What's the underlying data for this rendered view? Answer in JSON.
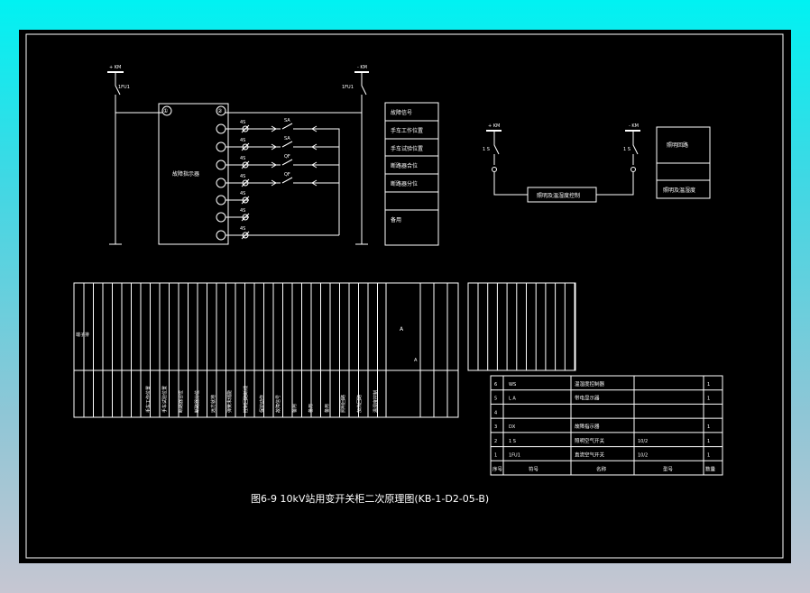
{
  "drawing": {
    "title": "图6-9 10kV站用变开关柜二次原理图(KB-1-D2-05-B)"
  },
  "left_circuit": {
    "device_label": "故障指示器",
    "bus_top_left": "+ KM",
    "bus_top_right": "- KM",
    "fuse_left": "1FU1",
    "fuse_right": "1FU1",
    "port_top": "①",
    "port_top_right": "②",
    "terminal_labels": [
      "4S",
      "4S",
      "4S",
      "4S",
      "4S",
      "4S",
      "4S"
    ],
    "contact_labels": [
      "SA",
      "SA",
      "QF",
      "QF"
    ],
    "signal_box": [
      "故障信号",
      "手车工作位置",
      "手车试验位置",
      "断路器合位",
      "断路器分位",
      "",
      "备用"
    ]
  },
  "right_circuit": {
    "device_label": "照明及温湿度控制",
    "bus_left": "+ KM",
    "bus_right": "- KM",
    "switch_left": "1 S",
    "switch_right": "1 S",
    "side_box": [
      "照明回路",
      "",
      "照明及温湿度"
    ]
  },
  "parts_table": {
    "rows": [
      {
        "no": "6",
        "code": "WS",
        "name": "温湿度控制器",
        "spec": "",
        "qty": "1"
      },
      {
        "no": "5",
        "code": "L A",
        "name": "带电显示器",
        "spec": "",
        "qty": "1"
      },
      {
        "no": "4",
        "code": "",
        "name": "",
        "spec": "",
        "qty": ""
      },
      {
        "no": "3",
        "code": "DX",
        "name": "故障指示器",
        "spec": "",
        "qty": "1"
      },
      {
        "no": "2",
        "code": "1 S",
        "name": "照明空气开关",
        "spec": "10/2",
        "qty": "1"
      },
      {
        "no": "1",
        "code": "1FU1",
        "name": "直流空气开关",
        "spec": "10/2",
        "qty": "1"
      }
    ],
    "header": {
      "no": "序号",
      "code": "符号",
      "name": "名称",
      "spec": "型号",
      "qty": "数量"
    }
  },
  "terminal_strip": {
    "row_labels": [
      "手车工作位置",
      "手车试验位置",
      "断路器合位",
      "断路器分位",
      "远方就地",
      "弹簧未储能",
      "控制回路断线",
      "保护动作",
      "故障信号",
      "备用",
      "备用",
      "备用",
      "照明回路",
      "加热回路",
      "温湿度控制"
    ],
    "header_label": "端子排",
    "mid_label": "A",
    "second_label": "A"
  }
}
